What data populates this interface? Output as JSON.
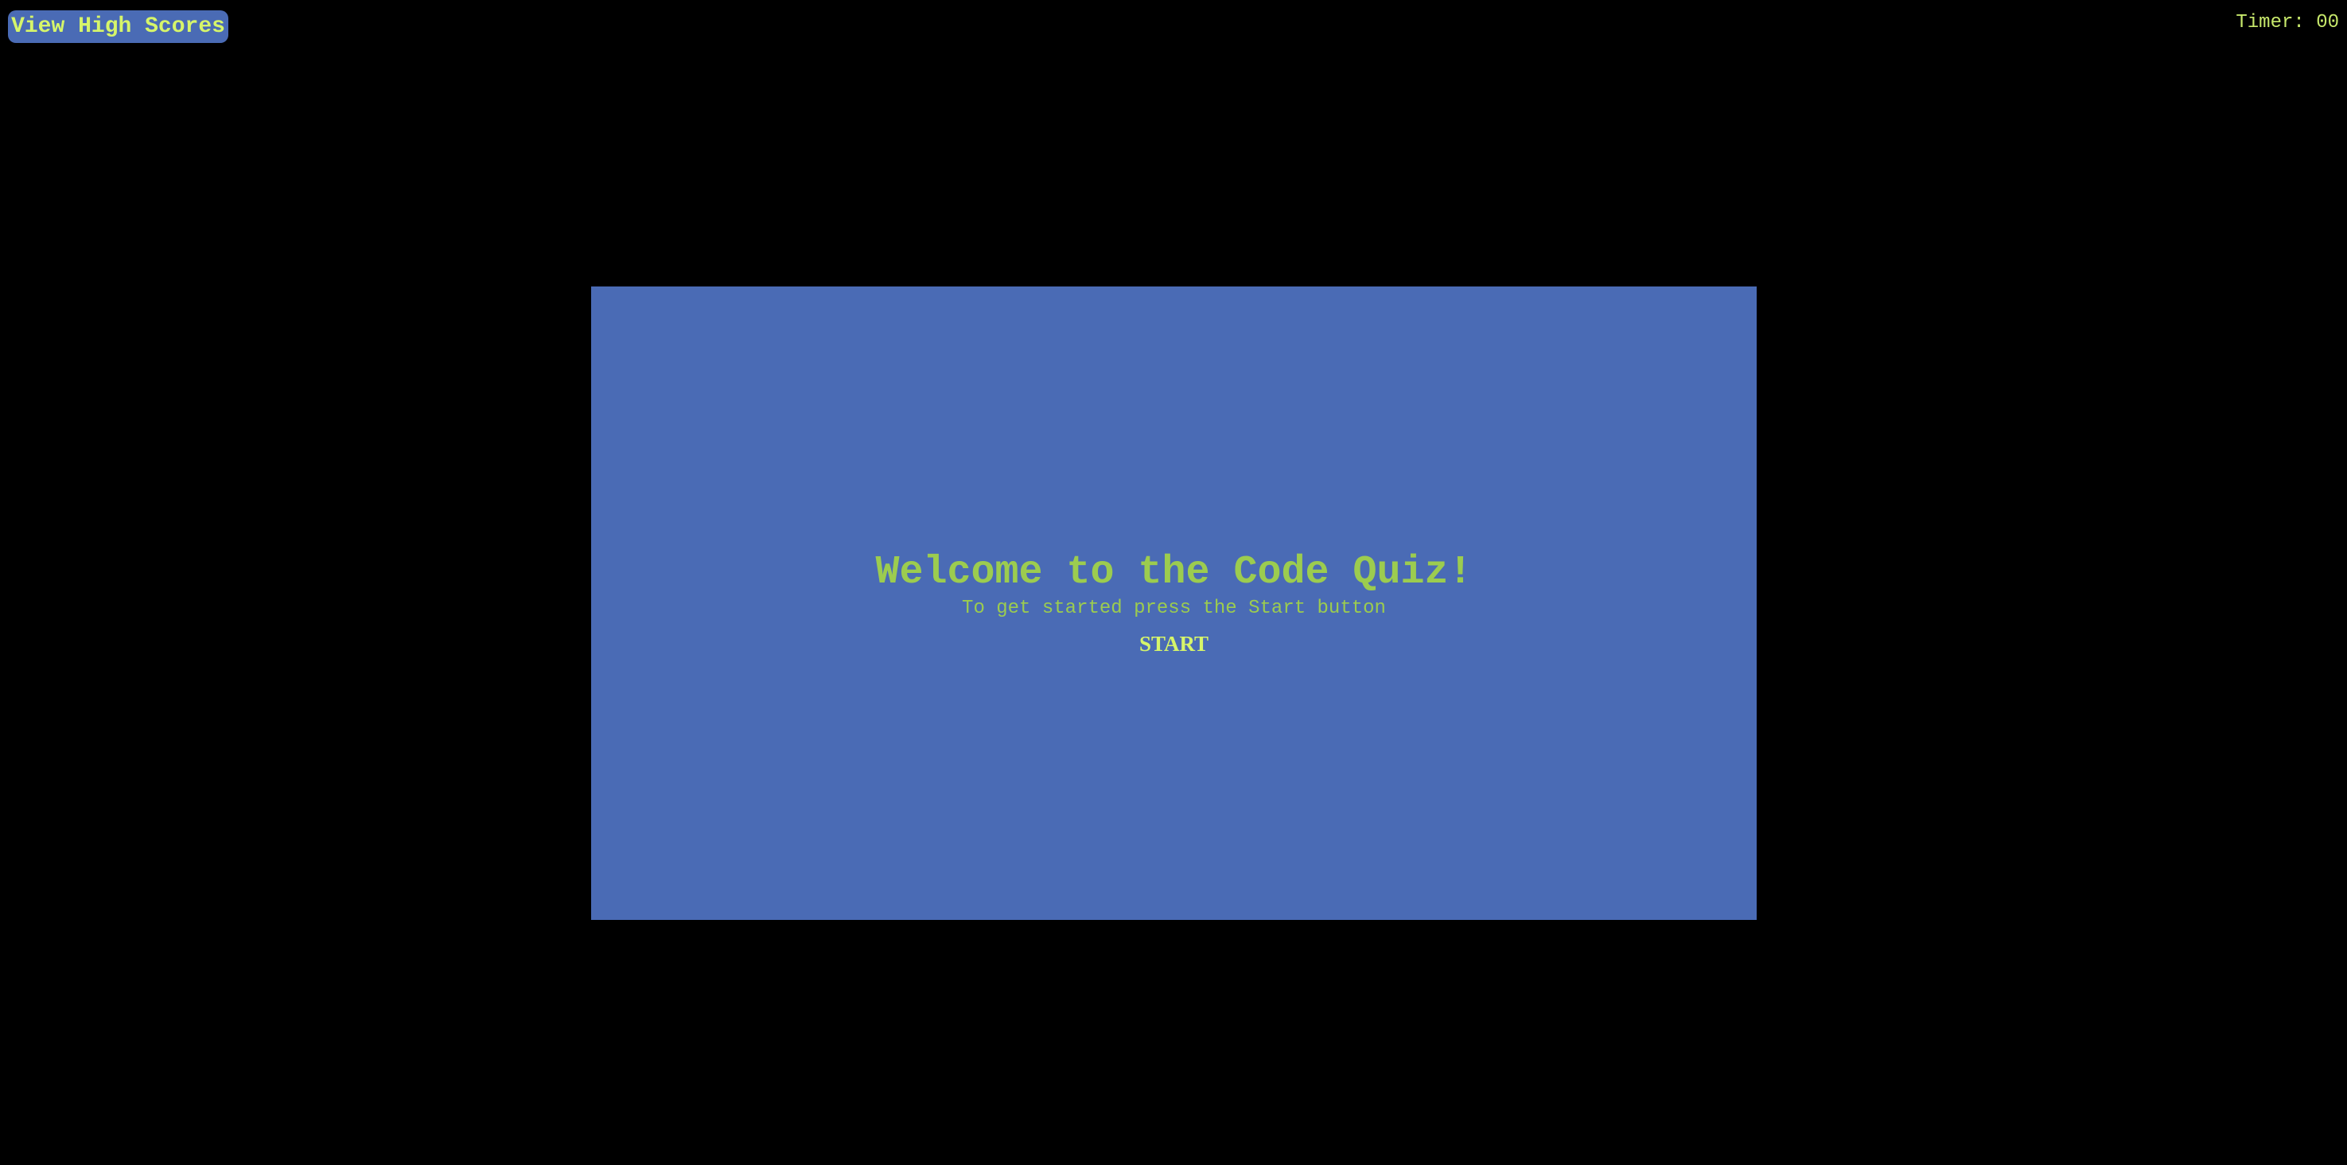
{
  "header": {
    "high_scores_label": "View High Scores",
    "timer_text": "Timer: 00"
  },
  "quiz": {
    "title": "Welcome to the Code Quiz!",
    "subtitle": "To get started press the Start button",
    "start_label": "START"
  },
  "colors": {
    "background": "#000000",
    "card": "#4a6bb5",
    "accent_text": "#9ccc4f",
    "highlight_text": "#d6f56a"
  }
}
